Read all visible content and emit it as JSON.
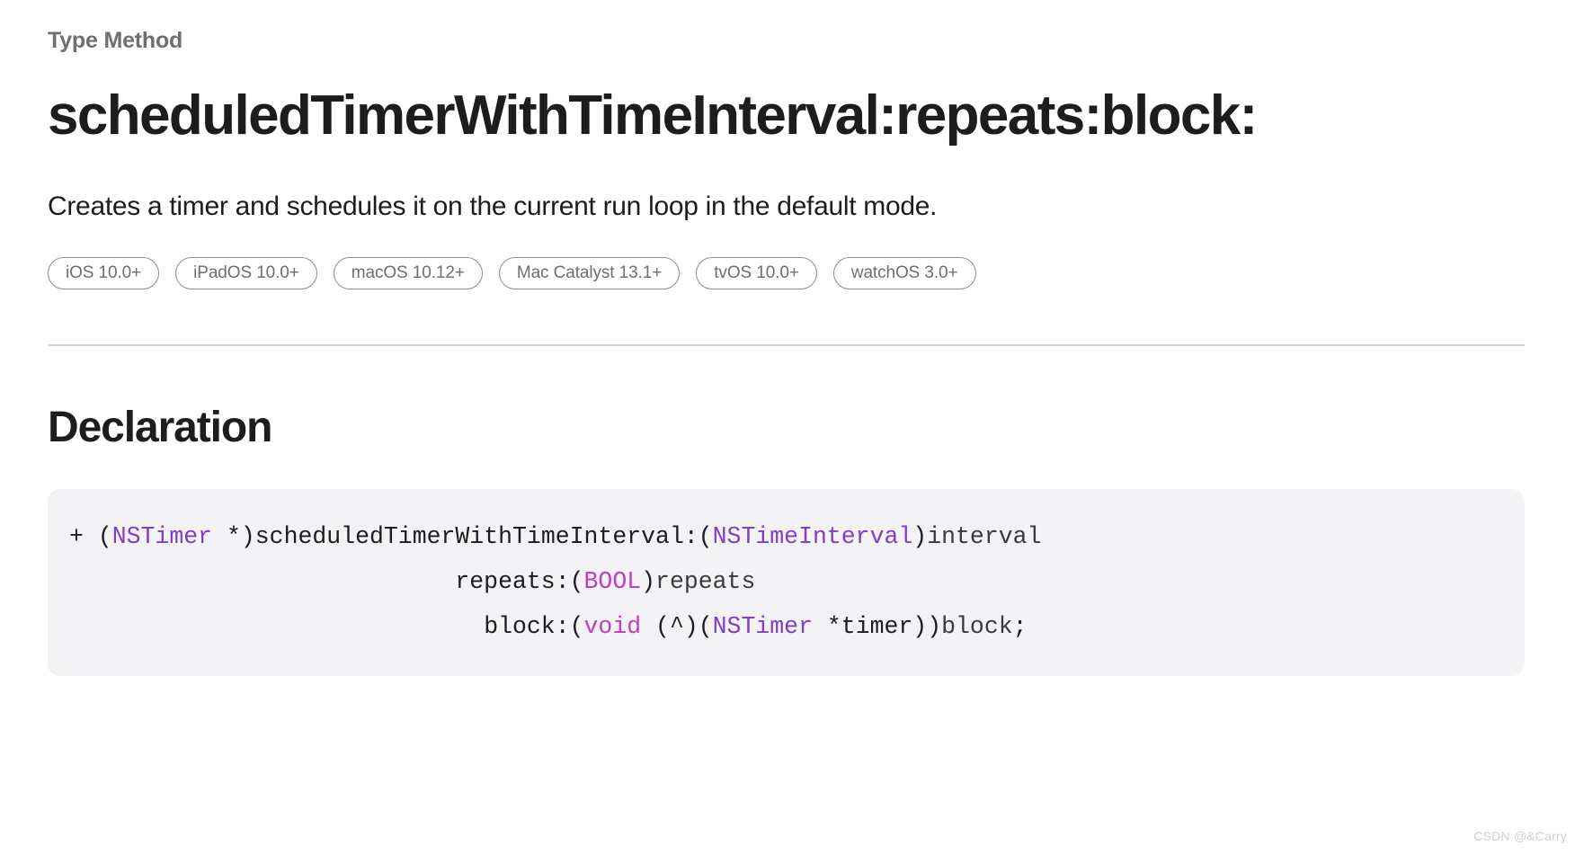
{
  "eyebrow": "Type Method",
  "title": "scheduledTimerWithTimeInterval:repeats:block:",
  "abstract": "Creates a timer and schedules it on the current run loop in the default mode.",
  "availability": [
    {
      "label": "iOS 10.0+"
    },
    {
      "label": "iPadOS 10.0+"
    },
    {
      "label": "macOS 10.12+"
    },
    {
      "label": "Mac Catalyst 13.1+"
    },
    {
      "label": "tvOS 10.0+"
    },
    {
      "label": "watchOS 3.0+"
    }
  ],
  "declaration": {
    "heading": "Declaration",
    "language": "objective-c",
    "lines": [
      {
        "indent": "",
        "tokens": [
          {
            "text": "+ ",
            "kind": "punct"
          },
          {
            "text": "(",
            "kind": "punct"
          },
          {
            "text": "NSTimer",
            "kind": "type"
          },
          {
            "text": " *)",
            "kind": "punct"
          },
          {
            "text": "scheduledTimerWithTimeInterval:",
            "kind": "ident"
          },
          {
            "text": "(",
            "kind": "punct"
          },
          {
            "text": "NSTimeInterval",
            "kind": "type"
          },
          {
            "text": ")",
            "kind": "punct"
          },
          {
            "text": "interval",
            "kind": "plain"
          }
        ]
      },
      {
        "indent": "                           ",
        "tokens": [
          {
            "text": "repeats:",
            "kind": "ident"
          },
          {
            "text": "(",
            "kind": "punct"
          },
          {
            "text": "BOOL",
            "kind": "keyword"
          },
          {
            "text": ")",
            "kind": "punct"
          },
          {
            "text": "repeats",
            "kind": "plain"
          }
        ]
      },
      {
        "indent": "                             ",
        "tokens": [
          {
            "text": "block:",
            "kind": "ident"
          },
          {
            "text": "(",
            "kind": "punct"
          },
          {
            "text": "void",
            "kind": "keyword"
          },
          {
            "text": " (^)(",
            "kind": "punct"
          },
          {
            "text": "NSTimer",
            "kind": "type"
          },
          {
            "text": " *timer))",
            "kind": "punct"
          },
          {
            "text": "block",
            "kind": "plain"
          },
          {
            "text": ";",
            "kind": "punct"
          }
        ]
      }
    ]
  },
  "watermark": "CSDN @&Carry",
  "colors": {
    "background": "#ffffff",
    "text_primary": "#1d1d1f",
    "text_secondary": "#6e6e73",
    "divider": "#d2d2d7",
    "code_background": "#f3f3f5",
    "code_type": "#7f3fbf",
    "code_keyword": "#bf3fbf",
    "badge_border": "#8e8e93"
  }
}
